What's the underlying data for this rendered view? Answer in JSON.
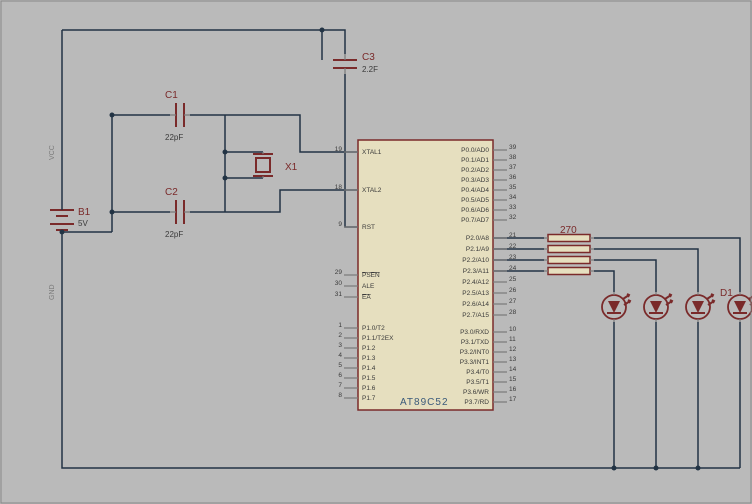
{
  "battery": {
    "name": "B1",
    "value": "5V"
  },
  "caps": {
    "c1": {
      "name": "C1",
      "value": "22pF"
    },
    "c2": {
      "name": "C2",
      "value": "22pF"
    },
    "c3": {
      "name": "C3",
      "value": "2.2F"
    }
  },
  "crystal": {
    "name": "X1"
  },
  "mcu": {
    "model": "AT89C52"
  },
  "respack": {
    "value": "270"
  },
  "led": {
    "name": "D1"
  },
  "rails": {
    "vcc": "VCC",
    "gnd": "GND"
  },
  "pins": {
    "left": [
      {
        "num": "19",
        "name": "XTAL1"
      },
      {
        "num": "18",
        "name": "XTAL2"
      },
      {
        "num": "9",
        "name": "RST"
      },
      {
        "num": "29",
        "name": "PSEN",
        "over": true
      },
      {
        "num": "30",
        "name": "ALE"
      },
      {
        "num": "31",
        "name": "EA",
        "over": true
      },
      {
        "num": "1",
        "name": "P1.0/T2"
      },
      {
        "num": "2",
        "name": "P1.1/T2EX"
      },
      {
        "num": "3",
        "name": "P1.2"
      },
      {
        "num": "4",
        "name": "P1.3"
      },
      {
        "num": "5",
        "name": "P1.4"
      },
      {
        "num": "6",
        "name": "P1.5"
      },
      {
        "num": "7",
        "name": "P1.6"
      },
      {
        "num": "8",
        "name": "P1.7"
      }
    ],
    "rightTop": [
      {
        "num": "39",
        "name": "P0.0/AD0"
      },
      {
        "num": "38",
        "name": "P0.1/AD1"
      },
      {
        "num": "37",
        "name": "P0.2/AD2"
      },
      {
        "num": "36",
        "name": "P0.3/AD3"
      },
      {
        "num": "35",
        "name": "P0.4/AD4"
      },
      {
        "num": "34",
        "name": "P0.5/AD5"
      },
      {
        "num": "33",
        "name": "P0.6/AD6"
      },
      {
        "num": "32",
        "name": "P0.7/AD7"
      }
    ],
    "rightMid": [
      {
        "num": "21",
        "name": "P2.0/A8"
      },
      {
        "num": "22",
        "name": "P2.1/A9"
      },
      {
        "num": "23",
        "name": "P2.2/A10"
      },
      {
        "num": "24",
        "name": "P2.3/A11"
      },
      {
        "num": "25",
        "name": "P2.4/A12"
      },
      {
        "num": "26",
        "name": "P2.5/A13"
      },
      {
        "num": "27",
        "name": "P2.6/A14"
      },
      {
        "num": "28",
        "name": "P2.7/A15"
      }
    ],
    "rightBot": [
      {
        "num": "10",
        "name": "P3.0/RXD"
      },
      {
        "num": "11",
        "name": "P3.1/TXD"
      },
      {
        "num": "12",
        "name": "P3.2/INT0"
      },
      {
        "num": "13",
        "name": "P3.3/INT1"
      },
      {
        "num": "14",
        "name": "P3.4/T0"
      },
      {
        "num": "15",
        "name": "P3.5/T1"
      },
      {
        "num": "16",
        "name": "P3.6/WR"
      },
      {
        "num": "17",
        "name": "P3.7/RD"
      }
    ]
  }
}
